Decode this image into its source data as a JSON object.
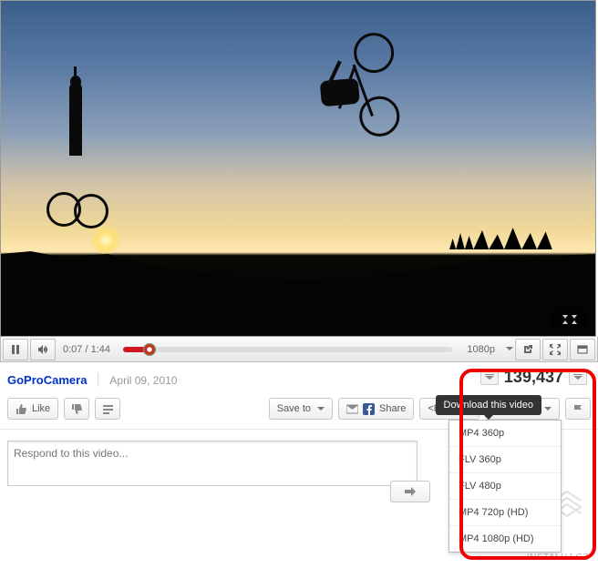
{
  "player": {
    "current_time": "0:07",
    "duration": "1:44",
    "quality": "1080p"
  },
  "info": {
    "channel": "GoProCamera",
    "date": "April 09, 2010",
    "views": "139,437"
  },
  "tooltip": "Download this video",
  "actions": {
    "like": "Like",
    "save_to": "Save to",
    "share": "Share",
    "embed": "<Embed>",
    "download": "Download"
  },
  "download_options": [
    "MP4 360p",
    "FLV 360p",
    "FLV 480p",
    "MP4 720p (HD)",
    "MP4 1080p (HD)"
  ],
  "comment": {
    "placeholder": "Respond to this video..."
  },
  "watermark": "INSTALUJ.CZ"
}
